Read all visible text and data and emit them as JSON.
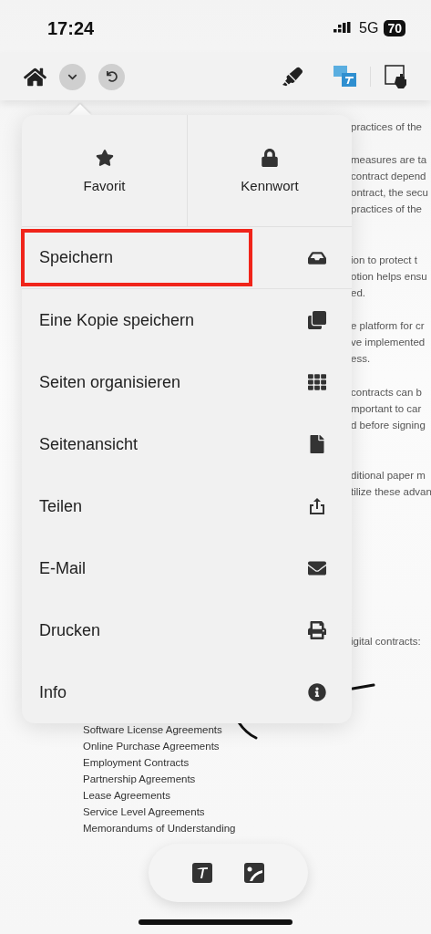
{
  "status_bar": {
    "time": "17:24",
    "network": "5G",
    "battery": "70"
  },
  "document": {
    "fragments": [
      [
        "practices of the"
      ],
      [
        "measures are ta",
        "contract depend",
        "ontract, the secu",
        "practices of the"
      ],
      [
        "ion to protect t",
        "otion helps ensu",
        "ed."
      ],
      [
        "e platform for cr",
        "ve implemented",
        "ess."
      ],
      [
        "contracts can b",
        "mportant to car",
        "d before signing"
      ],
      [
        "ditional paper m",
        "tilize these advan"
      ],
      [
        "igital contracts:"
      ]
    ],
    "list": [
      "Software License Agreements",
      "Online Purchase Agreements",
      "Employment Contracts",
      "Partnership Agreements",
      "Lease Agreements",
      "Service Level Agreements",
      "Memorandums of Understanding"
    ]
  },
  "menu": {
    "top": [
      {
        "label": "Favorit"
      },
      {
        "label": "Kennwort"
      }
    ],
    "items": [
      {
        "label": "Speichern",
        "highlighted": true
      },
      {
        "label": "Eine Kopie speichern",
        "highlighted": false
      },
      {
        "label": "Seiten organisieren",
        "highlighted": false
      },
      {
        "label": "Seitenansicht",
        "highlighted": false
      },
      {
        "label": "Teilen",
        "highlighted": false
      },
      {
        "label": "E-Mail",
        "highlighted": false
      },
      {
        "label": "Drucken",
        "highlighted": false
      },
      {
        "label": "Info",
        "highlighted": false
      }
    ]
  }
}
